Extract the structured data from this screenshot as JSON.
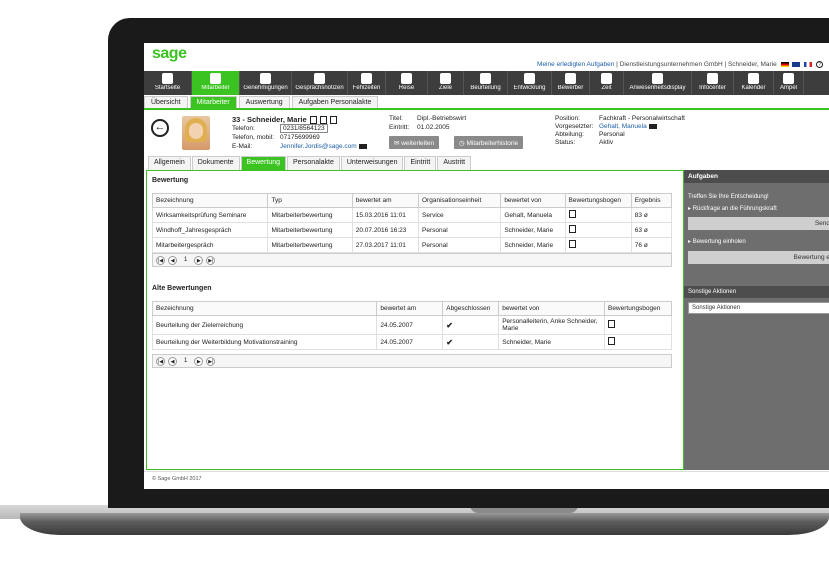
{
  "brand": {
    "logo": "sage"
  },
  "toplinks": {
    "tasks": "Meine erledigten Aufgaben",
    "company": "Dienstleistungsunternehmen GmbH",
    "user": "Schneider, Marie"
  },
  "nav": [
    "Startseite",
    "Mitarbeiter",
    "Genehmigungen",
    "Gesprächsnotizen",
    "Fehlzeiten",
    "Reise",
    "Ziele",
    "Beurteilung",
    "Entwicklung",
    "Bewerber",
    "Zeit",
    "Anwesenheitsdisplay",
    "Infocenter",
    "Kalender",
    "Ampel"
  ],
  "subtabs": [
    "Übersicht",
    "Mitarbeiter",
    "Auswertung",
    "Aufgaben Personalakte"
  ],
  "profile": {
    "name": "33 - Schneider, Marie",
    "phone_label": "Telefon:",
    "phone": "0231/8564123",
    "mobile_label": "Telefon, mobil:",
    "mobile": "07175699969",
    "email_label": "E-Mail:",
    "email": "Jennifer.Jordis@sage.com",
    "title_label": "Titel:",
    "title": "Dipl.-Betriebswirt",
    "entry_label": "Eintritt:",
    "entry": "01.02.2005",
    "position_label": "Position:",
    "position": "Fachkraft - Personalwirtschaft",
    "manager_label": "Vorgesetzter:",
    "manager": "Gehalt, Manuela",
    "department_label": "Abteilung:",
    "department": "Personal",
    "status_label": "Status:",
    "status": "Aktiv"
  },
  "buttons": {
    "forward": "weiterleiten",
    "history": "Mitarbeiterhistorie"
  },
  "ctabs": [
    "Allgemein",
    "Dokumente",
    "Bewertung",
    "Personalakte",
    "Unterweisungen",
    "Eintritt",
    "Austritt"
  ],
  "bewertung": {
    "title": "Bewertung",
    "headers": [
      "Bezeichnung",
      "Typ",
      "bewertet am",
      "Organisationseinheit",
      "bewertet von",
      "Bewertungsbogen",
      "Ergebnis"
    ],
    "rows": [
      [
        "Wirksamkeitsprüfung Seminare",
        "Mitarbeiterbewertung",
        "15.03.2016 11:01",
        "Service",
        "Gehalt, Manuela",
        "",
        "83 ø"
      ],
      [
        "Windhoff_Jahresgespräch",
        "Mitarbeiterbewertung",
        "20.07.2016 16:23",
        "Personal",
        "Schneider, Marie",
        "",
        "63 ø"
      ],
      [
        "Mitarbeitergespräch",
        "Mitarbeiterbewertung",
        "27.03.2017 11:01",
        "Personal",
        "Schneider, Marie",
        "",
        "76 ø"
      ]
    ],
    "page": "1"
  },
  "alte": {
    "title": "Alte Bewertungen",
    "headers": [
      "Bezeichnung",
      "bewertet am",
      "Abgeschlossen",
      "bewertet von",
      "Bewertungsbogen"
    ],
    "rows": [
      [
        "Beurteilung der Zielerreichung",
        "24.05.2007",
        "✔",
        "Personalleiterin, Anke Schneider, Marie",
        ""
      ],
      [
        "Beurteilung der Weiterbildung Motivationstraining",
        "24.05.2007",
        "✔",
        "Schneider, Marie",
        ""
      ]
    ],
    "page": "1"
  },
  "aufgaben": {
    "title": "Aufgaben",
    "decide": "Treffen Sie Ihre Entscheidung!",
    "item1": "Rückfrage an die Führungskraft",
    "btn1": "Send",
    "item2": "Bewertung einholen",
    "btn2": "Bewertung e",
    "other_title": "Sonstige Aktionen",
    "other_select": "Sonstige Aktionen"
  },
  "footer": {
    "copyright": "© Sage GmbH 2017"
  },
  "colors": {
    "accent": "#3bc321",
    "nav_bg": "#3d3d3d"
  }
}
